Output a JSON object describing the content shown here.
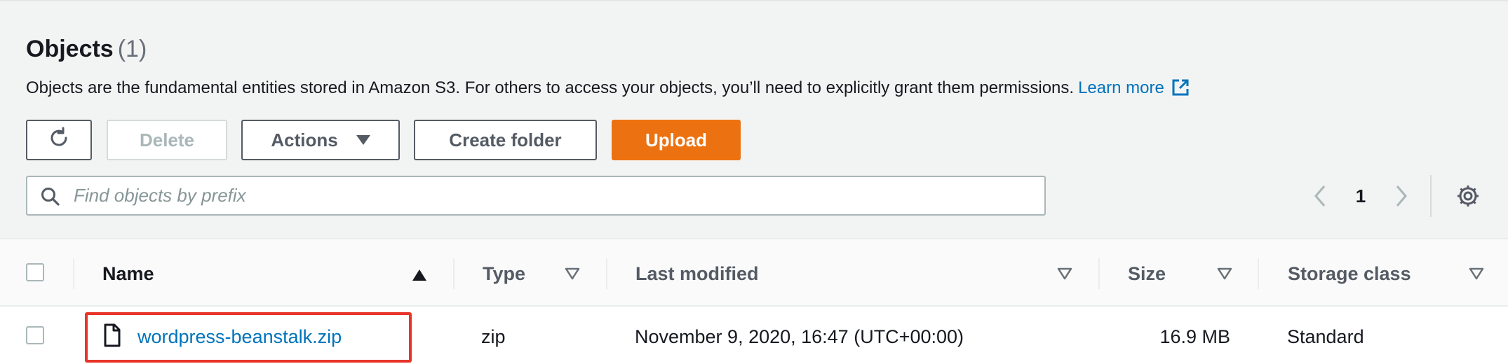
{
  "objects": {
    "title": "Objects",
    "count": "(1)",
    "description": "Objects are the fundamental entities stored in Amazon S3. For others to access your objects, you’ll need to explicitly grant them permissions.",
    "learn_more": "Learn more"
  },
  "toolbar": {
    "refresh_icon": "refresh-icon",
    "delete_label": "Delete",
    "actions_label": "Actions",
    "create_folder_label": "Create folder",
    "upload_label": "Upload"
  },
  "search": {
    "placeholder": "Find objects by prefix",
    "value": ""
  },
  "pagination": {
    "current_page": "1"
  },
  "table": {
    "columns": {
      "name": "Name",
      "type": "Type",
      "last_modified": "Last modified",
      "size": "Size",
      "storage_class": "Storage class"
    },
    "rows": [
      {
        "name": "wordpress-beanstalk.zip",
        "type": "zip",
        "last_modified": "November 9, 2020, 16:47 (UTC+00:00)",
        "size": "16.9 MB",
        "storage_class": "Standard"
      }
    ]
  },
  "colors": {
    "upload_button": "#ec7211",
    "link": "#0073bb",
    "highlight": "#e8352a"
  }
}
